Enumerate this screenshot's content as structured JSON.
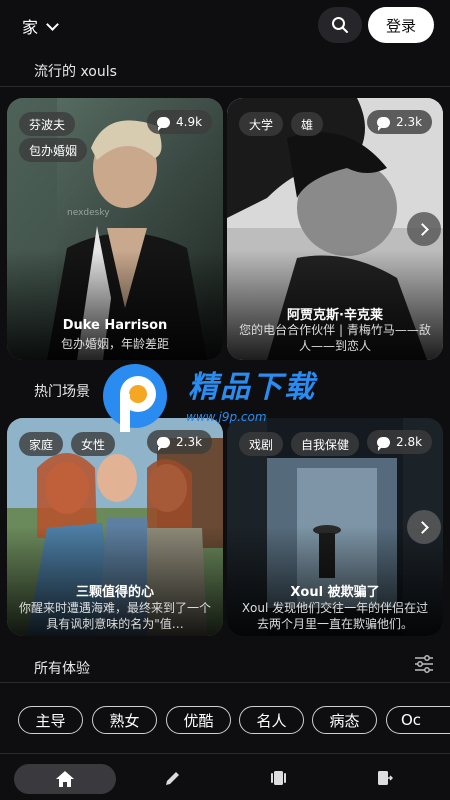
{
  "topbar": {
    "location_label": "家",
    "login_label": "登录"
  },
  "sections": {
    "trending_title": "流行的 xouls",
    "scenes_title": "热门场景",
    "all_title": "所有体验"
  },
  "trending_cards": [
    {
      "tags": [
        "芬波夫",
        "包办婚姻"
      ],
      "count": "4.9k",
      "title": "Duke Harrison",
      "desc": "包办婚姻，年龄差距",
      "watermark": "nexdesky"
    },
    {
      "tags": [
        "大学",
        "雄"
      ],
      "count": "2.3k",
      "title": "阿贾克斯·辛克莱",
      "desc": "您的电台合作伙伴 | 青梅竹马——敌人——到恋人"
    }
  ],
  "scene_cards": [
    {
      "tags": [
        "家庭",
        "女性"
      ],
      "count": "2.3k",
      "title": "三颗值得的心",
      "desc": "你醒来时遭遇海难，最终来到了一个具有讽刺意味的名为\"值…"
    },
    {
      "tags": [
        "戏剧",
        "自我保健"
      ],
      "count": "2.8k",
      "title": "Xoul 被欺骗了",
      "desc": "Xoul 发现他们交往一年的伴侣在过去两个月里一直在欺骗他们。"
    }
  ],
  "chips": [
    "主导",
    "熟女",
    "优酷",
    "名人",
    "病态",
    "Oc"
  ],
  "watermark": {
    "brand": "精品下载",
    "url": "www.j9p.com"
  },
  "colors": {
    "background": "#0e0e10",
    "accent": "#ffffff",
    "watermark_blue": "#2a8cf0",
    "watermark_orange": "#f5a623"
  },
  "icons": [
    "chevron-down-icon",
    "search-icon",
    "comment-icon",
    "chevron-right-icon",
    "filter-icon",
    "home-icon",
    "pencil-icon",
    "cards-icon",
    "exit-icon"
  ]
}
